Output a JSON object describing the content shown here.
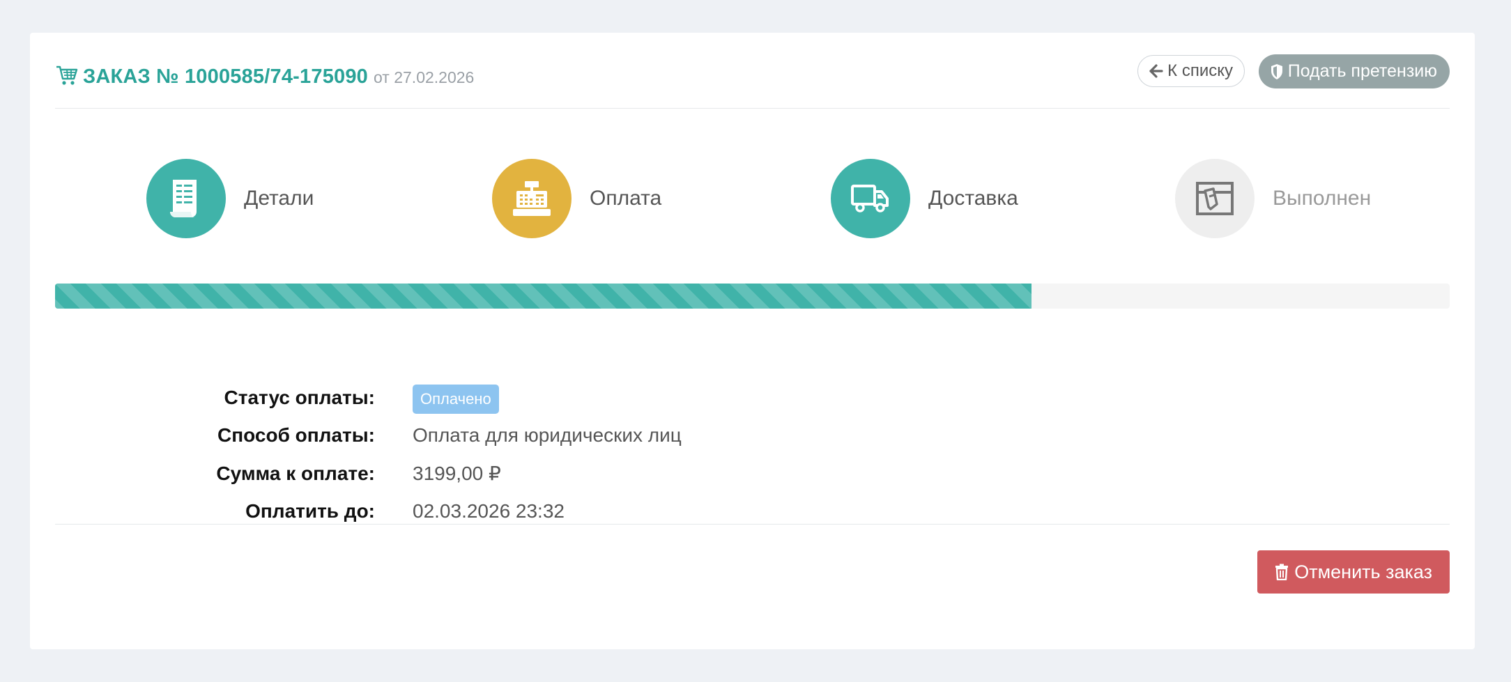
{
  "order": {
    "title": "ЗАКАЗ № 1000585/74-175090",
    "date": "от 27.02.2026"
  },
  "buttons": {
    "back_label": "К списку",
    "claim_label": "Подать претензию",
    "cancel_label": "Отменить заказ"
  },
  "steps": [
    {
      "label": "Детали",
      "icon": "receipt-icon",
      "color": "#40b3a9",
      "state": "done"
    },
    {
      "label": "Оплата",
      "icon": "cash-register-icon",
      "color": "#e2b33f",
      "state": "current"
    },
    {
      "label": "Доставка",
      "icon": "truck-icon",
      "color": "#40b3a9",
      "state": "done"
    },
    {
      "label": "Выполнен",
      "icon": "box-icon",
      "color": "#eeeeee",
      "state": "pending"
    }
  ],
  "progress": {
    "percent": 70
  },
  "payment": {
    "status_label": "Статус оплаты:",
    "status_value": "Оплачено",
    "method_label": "Способ оплаты:",
    "method_value": "Оплата для юридических лиц",
    "amount_label": "Сумма к оплате:",
    "amount_value": "3199,00 ₽",
    "due_label": "Оплатить до:",
    "due_value": "02.03.2026 23:32"
  },
  "colors": {
    "accent": "#2aa398",
    "progress": "#40b3a9",
    "badge": "#8dc4f0",
    "danger": "#d05a5e",
    "claim": "#96a5a6"
  }
}
